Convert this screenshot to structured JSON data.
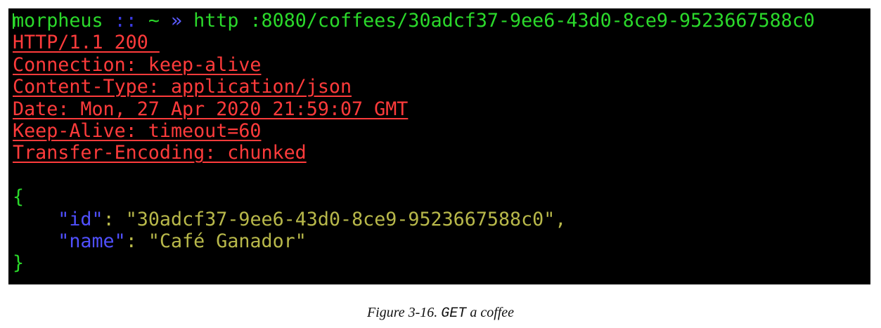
{
  "terminal": {
    "prompt": {
      "user": "morpheus",
      "separator": "::",
      "cwd": "~",
      "arrow": "»",
      "command": "http :8080/coffees/30adcf37-9ee6-43d0-8ce9-9523667588c0"
    },
    "response_headers": [
      "HTTP/1.1 200 ",
      "Connection: keep-alive",
      "Content-Type: application/json",
      "Date: Mon, 27 Apr 2020 21:59:07 GMT",
      "Keep-Alive: timeout=60",
      "Transfer-Encoding: chunked"
    ],
    "body": {
      "open_brace": "{",
      "close_brace": "}",
      "fields": [
        {
          "key": "id",
          "value": "30adcf37-9ee6-43d0-8ce9-9523667588c0",
          "comma": ","
        },
        {
          "key": "name",
          "value": "Café Ganador",
          "comma": ""
        }
      ]
    },
    "colors": {
      "background": "#000000",
      "prompt_green": "#2bd92b",
      "header_red": "#ff3b3b",
      "json_key_blue": "#5050ff",
      "json_value_olive": "#b8b84a"
    }
  },
  "caption": {
    "prefix": "Figure 3-16. ",
    "code": "GET",
    "suffix": " a coffee"
  }
}
